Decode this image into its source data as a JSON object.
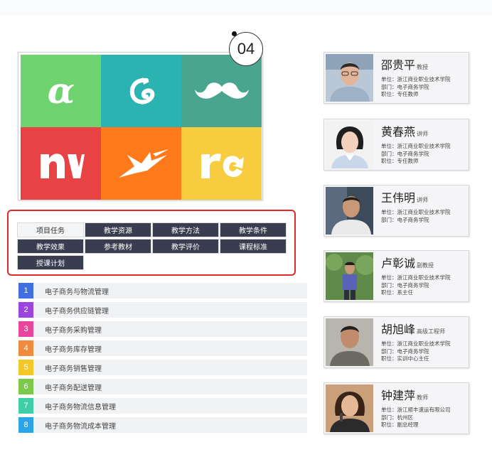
{
  "badge": "04",
  "tiles": [
    "alpha-logo",
    "swirl-logo",
    "mustache-logo",
    "nv-logo",
    "hummingbird-logo",
    "rc-arrow-logo"
  ],
  "colors": {
    "green": "#6fd46f",
    "teal": "#2bb3b1",
    "darkteal": "#4aa58f",
    "red": "#e84244",
    "orange": "#ff7a1a",
    "yellow": "#f7cc3e",
    "nav_dark": "#3a3d4f",
    "frame_red": "#e02a2a"
  },
  "nav": {
    "items": [
      "项目任务",
      "教学资源",
      "教学方法",
      "教学条件",
      "教学效果",
      "参考教材",
      "教学评价",
      "课程标准",
      "授课计划"
    ],
    "active_index": 0
  },
  "list": {
    "items": [
      {
        "num": "1",
        "text": "电子商务与物流管理",
        "color": "#3f6fe0"
      },
      {
        "num": "2",
        "text": "电子商务供应链管理",
        "color": "#9b44e0"
      },
      {
        "num": "3",
        "text": "电子商务采购管理",
        "color": "#e8459c"
      },
      {
        "num": "4",
        "text": "电子商务库存管理",
        "color": "#f08a3c"
      },
      {
        "num": "5",
        "text": "电子商务销售管理",
        "color": "#f5c829"
      },
      {
        "num": "6",
        "text": "电子商务配送管理",
        "color": "#7bc84a"
      },
      {
        "num": "7",
        "text": "电子商务物流信息管理",
        "color": "#3fcfa8"
      },
      {
        "num": "8",
        "text": "电子商务物流成本管理",
        "color": "#2aa5e8"
      }
    ]
  },
  "cards": [
    {
      "name": "邵贵平",
      "title": "教授",
      "lines": [
        "单位：浙江商业职业技术学院",
        "部门：电子商务学院",
        "职位：专任教师"
      ]
    },
    {
      "name": "黄春燕",
      "title": "讲师",
      "lines": [
        "单位：浙江商业职业技术学院",
        "部门：电子商务学院",
        "职位：专任教师"
      ]
    },
    {
      "name": "王伟明",
      "title": "讲师",
      "lines": [
        "单位：浙江商业职业技术学院",
        "部门：电子商务学院"
      ]
    },
    {
      "name": "卢彰诚",
      "title": "副教授",
      "lines": [
        "单位：浙江商业职业技术学院",
        "部门：电子商务学院",
        "职位：系主任"
      ]
    },
    {
      "name": "胡旭峰",
      "title": "高级工程师",
      "lines": [
        "单位：浙江商业职业技术学院",
        "部门：电子商务学院",
        "职位：实训中心主任"
      ]
    },
    {
      "name": "钟建萍",
      "title": "教师",
      "lines": [
        "单位：浙江顺丰速运有限公司",
        "部门：杭州区",
        "职位：副总经理"
      ]
    }
  ]
}
